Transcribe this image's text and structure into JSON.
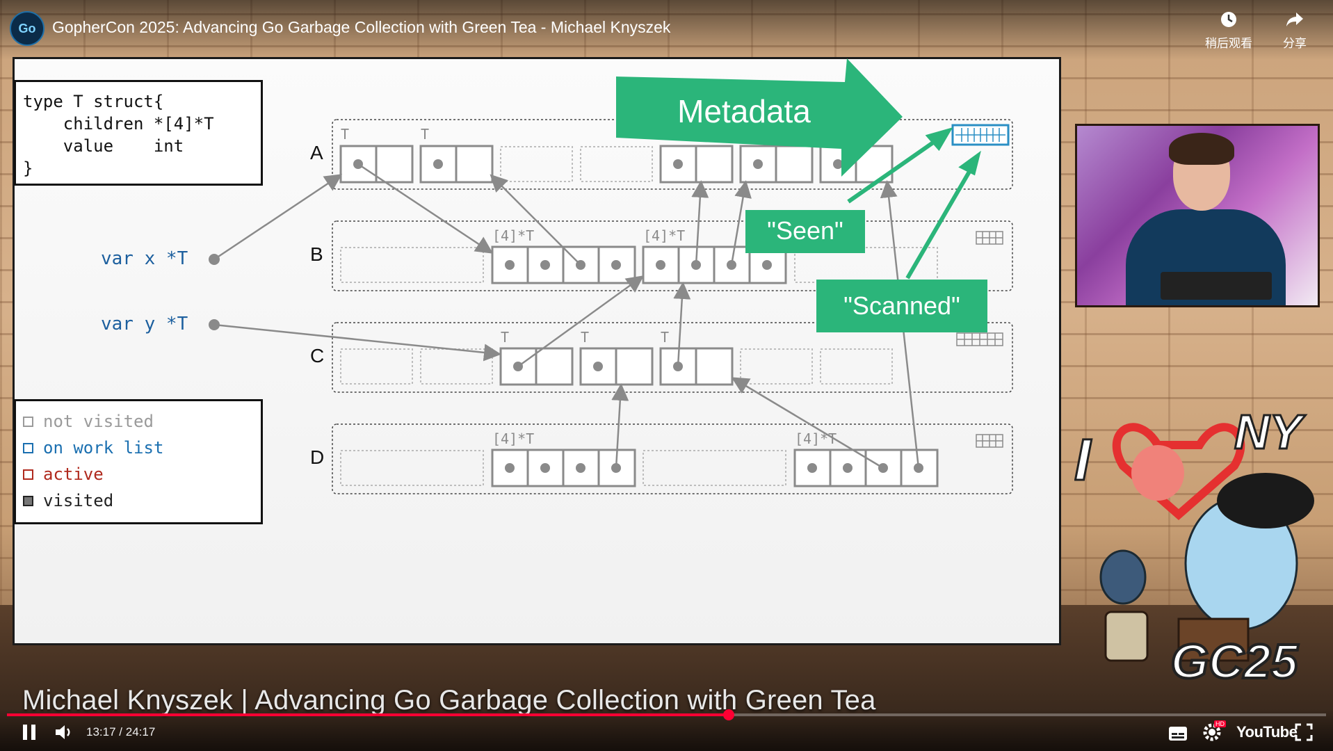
{
  "video": {
    "title": "GopherCon 2025: Advancing Go Garbage Collection with Green Tea - Michael Knyszek",
    "channel_logo_text": "Go",
    "watch_later_label": "稍后观看",
    "share_label": "分享",
    "caption": "Michael Knyszek | Advancing Go Garbage Collection with Green Tea",
    "time_current": "13:17",
    "time_separator": "/",
    "time_total": "24:17",
    "progress": 0.547,
    "youtube_label": "YouTube",
    "hd_badge": "HD"
  },
  "slide": {
    "code_lines": [
      "type T struct{",
      "    children *[4]*T",
      "    value    int",
      "}"
    ],
    "var_x": "var x *T",
    "var_y": "var y *T",
    "row_labels": [
      "A",
      "B",
      "C",
      "D"
    ],
    "type_T": "T",
    "type_arr": "[4]*T",
    "legend": [
      {
        "label": "not visited",
        "color": "#9a9a9a"
      },
      {
        "label": "on work list",
        "color": "#1a6fb0"
      },
      {
        "label": "active",
        "color": "#b02a1e"
      },
      {
        "label": "visited",
        "color": "#222222"
      }
    ],
    "callouts": {
      "metadata": "Metadata",
      "seen": "\"Seen\"",
      "scanned": "\"Scanned\""
    },
    "accent_green": "#2bb57a",
    "accent_blue": "#2a8fc4"
  },
  "overlay": {
    "i_love_ny_i": "I",
    "i_love_ny_ny": "NY",
    "event_logo": "GC25"
  }
}
